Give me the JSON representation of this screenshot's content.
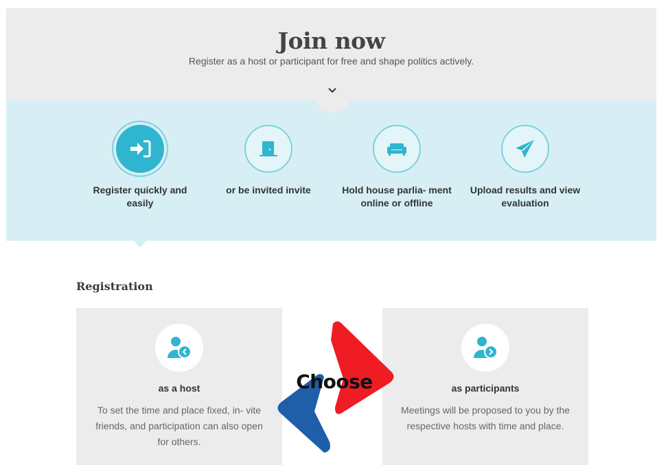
{
  "hero": {
    "title": "Join now",
    "subtitle": "Register as a host or participant for free and shape politics actively."
  },
  "steps": [
    {
      "label": "Register quickly and easily",
      "icon": "sign-in-icon",
      "active": true
    },
    {
      "label": "or be invited invite",
      "icon": "door-icon",
      "active": false
    },
    {
      "label": "Hold house parlia- ment online or offline",
      "icon": "sofa-icon",
      "active": false
    },
    {
      "label": "Upload results and view evaluation",
      "icon": "paper-plane-icon",
      "active": false
    }
  ],
  "registration": {
    "title": "Registration",
    "host": {
      "title": "as a host",
      "text": "To set the time and place fixed, in- vite friends, and participation can also open for others.",
      "icon": "host-users-icon"
    },
    "participant": {
      "title": "as participants",
      "text": "Meetings will be proposed to you by the respective hosts with time and place.",
      "icon": "participant-users-icon"
    }
  },
  "overlay": {
    "text": "Choose"
  },
  "colors": {
    "accent": "#2fb5d0",
    "steps_bg": "#d7eff4",
    "hero_bg": "#ececec",
    "arrow_blue": "#1f5faa",
    "arrow_red": "#ef1c24"
  }
}
